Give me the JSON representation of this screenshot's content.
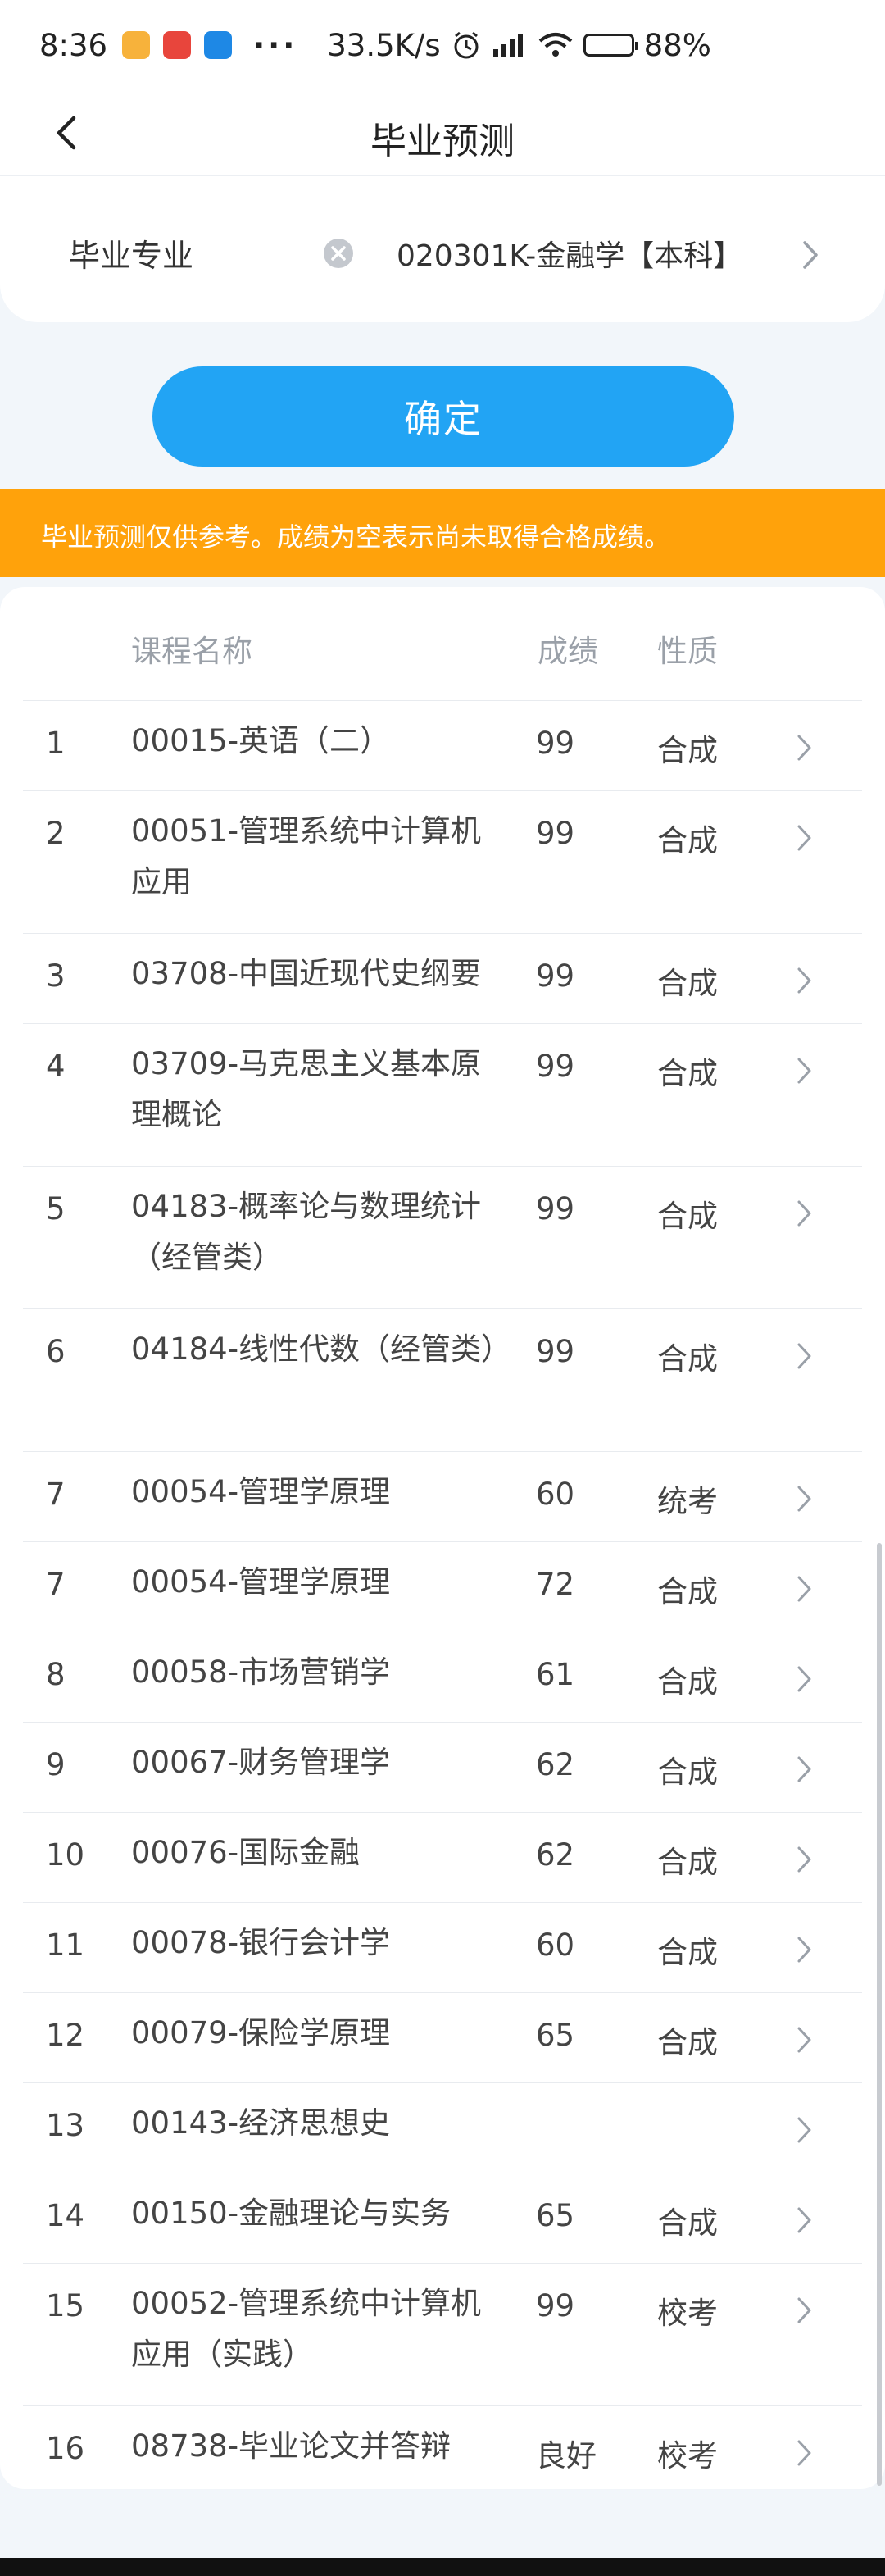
{
  "status_bar": {
    "time": "8:36",
    "dots": "···",
    "net_speed": "33.5K/s",
    "battery": "88%",
    "colors": {
      "app1": "#f7b23b",
      "app2": "#e8453c",
      "app3": "#1e88e5"
    }
  },
  "header": {
    "title": "毕业预测"
  },
  "major": {
    "label": "毕业专业",
    "value": "020301K-金融学【本科】"
  },
  "confirm_label": "确定",
  "notice": "毕业预测仅供参考。成绩为空表示尚未取得合格成绩。",
  "table": {
    "headers": {
      "name": "课程名称",
      "score": "成绩",
      "nature": "性质"
    },
    "rows": [
      {
        "idx": "1",
        "name": "00015-英语（二）",
        "score": "99",
        "nature": "合成"
      },
      {
        "idx": "2",
        "name": "00051-管理系统中计算机应用",
        "score": "99",
        "nature": "合成"
      },
      {
        "idx": "3",
        "name": "03708-中国近现代史纲要",
        "score": "99",
        "nature": "合成"
      },
      {
        "idx": "4",
        "name": "03709-马克思主义基本原理概论",
        "score": "99",
        "nature": "合成"
      },
      {
        "idx": "5",
        "name": "04183-概率论与数理统计（经管类）",
        "score": "99",
        "nature": "合成"
      },
      {
        "idx": "6",
        "name": "04184-线性代数（经管类）",
        "score": "99",
        "nature": "合成"
      },
      {
        "idx": "7",
        "name": "00054-管理学原理",
        "score": "60",
        "nature": "统考"
      },
      {
        "idx": "7",
        "name": "00054-管理学原理",
        "score": "72",
        "nature": "合成"
      },
      {
        "idx": "8",
        "name": "00058-市场营销学",
        "score": "61",
        "nature": "合成"
      },
      {
        "idx": "9",
        "name": "00067-财务管理学",
        "score": "62",
        "nature": "合成"
      },
      {
        "idx": "10",
        "name": "00076-国际金融",
        "score": "62",
        "nature": "合成"
      },
      {
        "idx": "11",
        "name": "00078-银行会计学",
        "score": "60",
        "nature": "合成"
      },
      {
        "idx": "12",
        "name": "00079-保险学原理",
        "score": "65",
        "nature": "合成"
      },
      {
        "idx": "13",
        "name": "00143-经济思想史",
        "score": "",
        "nature": ""
      },
      {
        "idx": "14",
        "name": "00150-金融理论与实务",
        "score": "65",
        "nature": "合成"
      },
      {
        "idx": "15",
        "name": "00052-管理系统中计算机应用（实践）",
        "score": "99",
        "nature": "校考"
      },
      {
        "idx": "16",
        "name": "08738-毕业论文并答辩",
        "score": "良好",
        "nature": "校考"
      }
    ]
  },
  "colors": {
    "accent": "#22a4f4",
    "notice_bg": "#ffa20b",
    "page_bg": "#f2f6fa"
  }
}
